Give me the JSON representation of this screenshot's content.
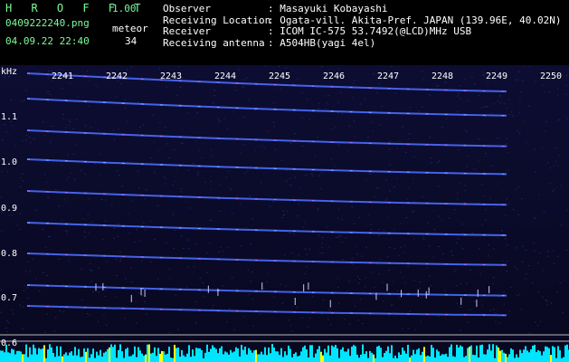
{
  "header": {
    "app_name": "H R O F F T",
    "version": "1.00",
    "filename": "0409222240.png",
    "datetime": "04.09.22 22:40",
    "meteor_label": "meteor",
    "meteor_count": "34",
    "fields": [
      {
        "label": "Observer",
        "value": ": Masayuki Kobayashi"
      },
      {
        "label": "Receiving Location",
        "value": ": Ogata-vill. Akita-Pref. JAPAN (139.96E, 40.02N)"
      },
      {
        "label": "Receiver",
        "value": ": ICOM IC-575 53.7492(@LCD)MHz USB"
      },
      {
        "label": "Receiving antenna",
        "value": ": A504HB(yagi 4el)"
      }
    ]
  },
  "spectrogram": {
    "unit_label": "kHz",
    "time_ticks": [
      "2241",
      "2242",
      "2243",
      "2244",
      "2245",
      "2246",
      "2247",
      "2248",
      "2249",
      "2250"
    ],
    "freq_ticks": [
      "1.1",
      "1.0",
      "0.9",
      "0.8",
      "0.7",
      "0.6"
    ],
    "colors": {
      "background": "#0a0a2a",
      "trace": "#4a6cff",
      "activity": "#00e5ff",
      "spike": "#ffff00"
    }
  }
}
